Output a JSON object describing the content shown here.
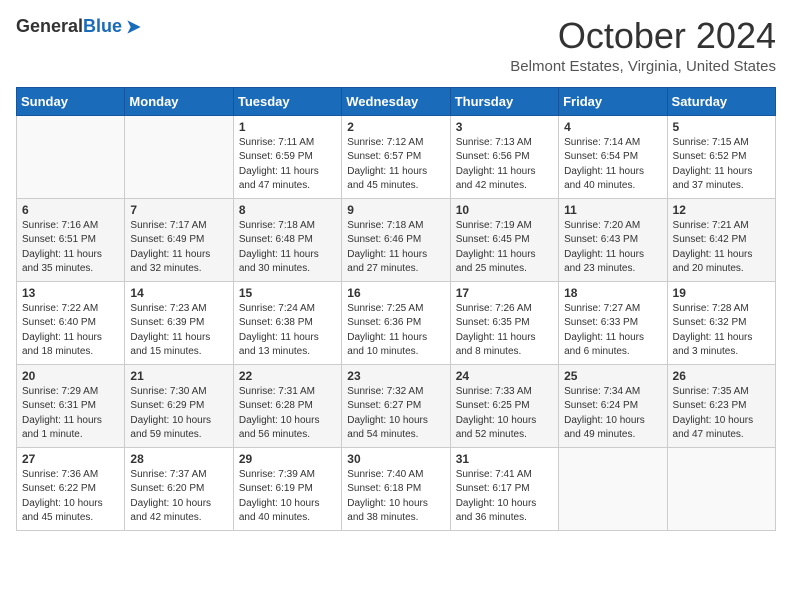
{
  "header": {
    "logo_general": "General",
    "logo_blue": "Blue",
    "month_title": "October 2024",
    "location": "Belmont Estates, Virginia, United States"
  },
  "days_of_week": [
    "Sunday",
    "Monday",
    "Tuesday",
    "Wednesday",
    "Thursday",
    "Friday",
    "Saturday"
  ],
  "weeks": [
    [
      {
        "day": "",
        "info": ""
      },
      {
        "day": "",
        "info": ""
      },
      {
        "day": "1",
        "info": "Sunrise: 7:11 AM\nSunset: 6:59 PM\nDaylight: 11 hours and 47 minutes."
      },
      {
        "day": "2",
        "info": "Sunrise: 7:12 AM\nSunset: 6:57 PM\nDaylight: 11 hours and 45 minutes."
      },
      {
        "day": "3",
        "info": "Sunrise: 7:13 AM\nSunset: 6:56 PM\nDaylight: 11 hours and 42 minutes."
      },
      {
        "day": "4",
        "info": "Sunrise: 7:14 AM\nSunset: 6:54 PM\nDaylight: 11 hours and 40 minutes."
      },
      {
        "day": "5",
        "info": "Sunrise: 7:15 AM\nSunset: 6:52 PM\nDaylight: 11 hours and 37 minutes."
      }
    ],
    [
      {
        "day": "6",
        "info": "Sunrise: 7:16 AM\nSunset: 6:51 PM\nDaylight: 11 hours and 35 minutes."
      },
      {
        "day": "7",
        "info": "Sunrise: 7:17 AM\nSunset: 6:49 PM\nDaylight: 11 hours and 32 minutes."
      },
      {
        "day": "8",
        "info": "Sunrise: 7:18 AM\nSunset: 6:48 PM\nDaylight: 11 hours and 30 minutes."
      },
      {
        "day": "9",
        "info": "Sunrise: 7:18 AM\nSunset: 6:46 PM\nDaylight: 11 hours and 27 minutes."
      },
      {
        "day": "10",
        "info": "Sunrise: 7:19 AM\nSunset: 6:45 PM\nDaylight: 11 hours and 25 minutes."
      },
      {
        "day": "11",
        "info": "Sunrise: 7:20 AM\nSunset: 6:43 PM\nDaylight: 11 hours and 23 minutes."
      },
      {
        "day": "12",
        "info": "Sunrise: 7:21 AM\nSunset: 6:42 PM\nDaylight: 11 hours and 20 minutes."
      }
    ],
    [
      {
        "day": "13",
        "info": "Sunrise: 7:22 AM\nSunset: 6:40 PM\nDaylight: 11 hours and 18 minutes."
      },
      {
        "day": "14",
        "info": "Sunrise: 7:23 AM\nSunset: 6:39 PM\nDaylight: 11 hours and 15 minutes."
      },
      {
        "day": "15",
        "info": "Sunrise: 7:24 AM\nSunset: 6:38 PM\nDaylight: 11 hours and 13 minutes."
      },
      {
        "day": "16",
        "info": "Sunrise: 7:25 AM\nSunset: 6:36 PM\nDaylight: 11 hours and 10 minutes."
      },
      {
        "day": "17",
        "info": "Sunrise: 7:26 AM\nSunset: 6:35 PM\nDaylight: 11 hours and 8 minutes."
      },
      {
        "day": "18",
        "info": "Sunrise: 7:27 AM\nSunset: 6:33 PM\nDaylight: 11 hours and 6 minutes."
      },
      {
        "day": "19",
        "info": "Sunrise: 7:28 AM\nSunset: 6:32 PM\nDaylight: 11 hours and 3 minutes."
      }
    ],
    [
      {
        "day": "20",
        "info": "Sunrise: 7:29 AM\nSunset: 6:31 PM\nDaylight: 11 hours and 1 minute."
      },
      {
        "day": "21",
        "info": "Sunrise: 7:30 AM\nSunset: 6:29 PM\nDaylight: 10 hours and 59 minutes."
      },
      {
        "day": "22",
        "info": "Sunrise: 7:31 AM\nSunset: 6:28 PM\nDaylight: 10 hours and 56 minutes."
      },
      {
        "day": "23",
        "info": "Sunrise: 7:32 AM\nSunset: 6:27 PM\nDaylight: 10 hours and 54 minutes."
      },
      {
        "day": "24",
        "info": "Sunrise: 7:33 AM\nSunset: 6:25 PM\nDaylight: 10 hours and 52 minutes."
      },
      {
        "day": "25",
        "info": "Sunrise: 7:34 AM\nSunset: 6:24 PM\nDaylight: 10 hours and 49 minutes."
      },
      {
        "day": "26",
        "info": "Sunrise: 7:35 AM\nSunset: 6:23 PM\nDaylight: 10 hours and 47 minutes."
      }
    ],
    [
      {
        "day": "27",
        "info": "Sunrise: 7:36 AM\nSunset: 6:22 PM\nDaylight: 10 hours and 45 minutes."
      },
      {
        "day": "28",
        "info": "Sunrise: 7:37 AM\nSunset: 6:20 PM\nDaylight: 10 hours and 42 minutes."
      },
      {
        "day": "29",
        "info": "Sunrise: 7:39 AM\nSunset: 6:19 PM\nDaylight: 10 hours and 40 minutes."
      },
      {
        "day": "30",
        "info": "Sunrise: 7:40 AM\nSunset: 6:18 PM\nDaylight: 10 hours and 38 minutes."
      },
      {
        "day": "31",
        "info": "Sunrise: 7:41 AM\nSunset: 6:17 PM\nDaylight: 10 hours and 36 minutes."
      },
      {
        "day": "",
        "info": ""
      },
      {
        "day": "",
        "info": ""
      }
    ]
  ]
}
